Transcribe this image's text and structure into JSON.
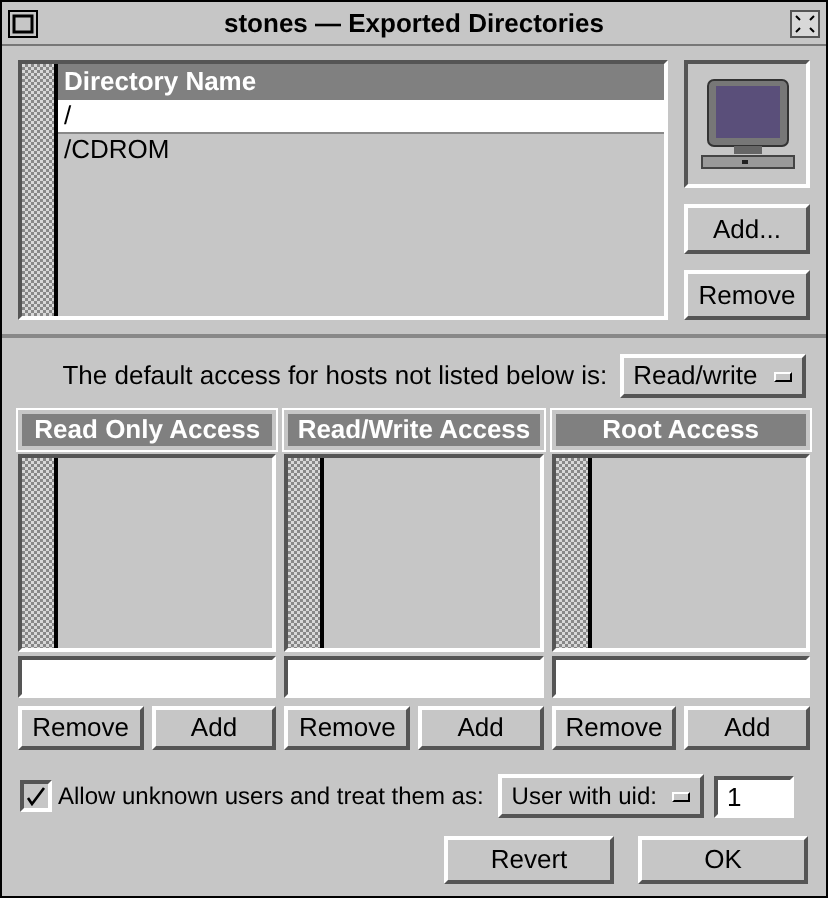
{
  "window": {
    "title": "stones — Exported Directories"
  },
  "directories": {
    "column": "Directory Name",
    "rows": [
      {
        "name": "/",
        "selected": true
      },
      {
        "name": "/CDROM",
        "selected": false
      }
    ]
  },
  "directory_buttons": [
    "Add...",
    "Remove"
  ],
  "default_access": {
    "label": "The default access for hosts not listed below is:",
    "value": "Read/write"
  },
  "access_lists": [
    {
      "title": "Read Only Access",
      "buttons": [
        "Remove",
        "Add"
      ]
    },
    {
      "title": "Read/Write Access",
      "buttons": [
        "Remove",
        "Add"
      ]
    },
    {
      "title": "Root Access",
      "buttons": [
        "Remove",
        "Add"
      ]
    }
  ],
  "unknown_users": {
    "label": "Allow unknown users and treat them as:",
    "checked": true,
    "mode": "User with uid:",
    "uid": "1"
  },
  "buttons": [
    "Revert",
    "OK"
  ]
}
